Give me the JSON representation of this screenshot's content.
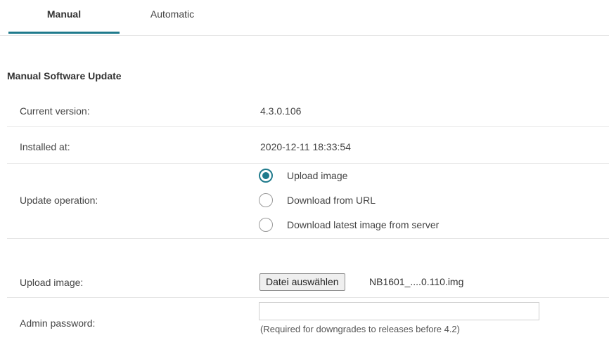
{
  "tabs": [
    {
      "label": "Manual",
      "active": true
    },
    {
      "label": "Automatic",
      "active": false
    }
  ],
  "section_title": "Manual Software Update",
  "rows": {
    "current_version": {
      "label": "Current version:",
      "value": "4.3.0.106"
    },
    "installed_at": {
      "label": "Installed at:",
      "value": "2020-12-11 18:33:54"
    },
    "update_operation": {
      "label": "Update operation:",
      "options": [
        {
          "label": "Upload image",
          "checked": true
        },
        {
          "label": "Download from URL",
          "checked": false
        },
        {
          "label": "Download latest image from server",
          "checked": false
        }
      ]
    },
    "upload_image": {
      "label": "Upload image:",
      "button_label": "Datei auswählen",
      "file_name": "NB1601_....0.110.img"
    },
    "admin_password": {
      "label": "Admin password:",
      "value": "",
      "hint": "(Required for downgrades to releases before 4.2)"
    }
  },
  "colors": {
    "accent": "#1f7a8c",
    "separator": "#e6e6e6"
  }
}
